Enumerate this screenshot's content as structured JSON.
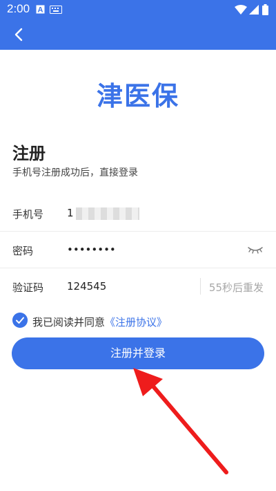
{
  "status_bar": {
    "time": "2:00",
    "notification_icons": [
      "a-notification-icon",
      "keyboard-icon"
    ],
    "system_icons": [
      "wifi-icon",
      "signal-icon",
      "battery-icon"
    ]
  },
  "header": {
    "back_icon": "chevron-left-icon"
  },
  "logo_text": "津医保",
  "page": {
    "title": "注册",
    "subtitle": "手机号注册成功后，直接登录"
  },
  "form": {
    "phone": {
      "label": "手机号",
      "value": "1"
    },
    "password": {
      "label": "密码",
      "value": "••••••••",
      "toggle_icon": "eye-closed-icon"
    },
    "code": {
      "label": "验证码",
      "value": "124545",
      "resend": "55秒后重发"
    }
  },
  "agreement": {
    "checked": true,
    "text": "我已阅读并同意",
    "link": "《注册协议》"
  },
  "submit_label": "注册并登录",
  "colors": {
    "primary": "#3b73e8",
    "annotation_arrow": "#ee1c1c"
  }
}
